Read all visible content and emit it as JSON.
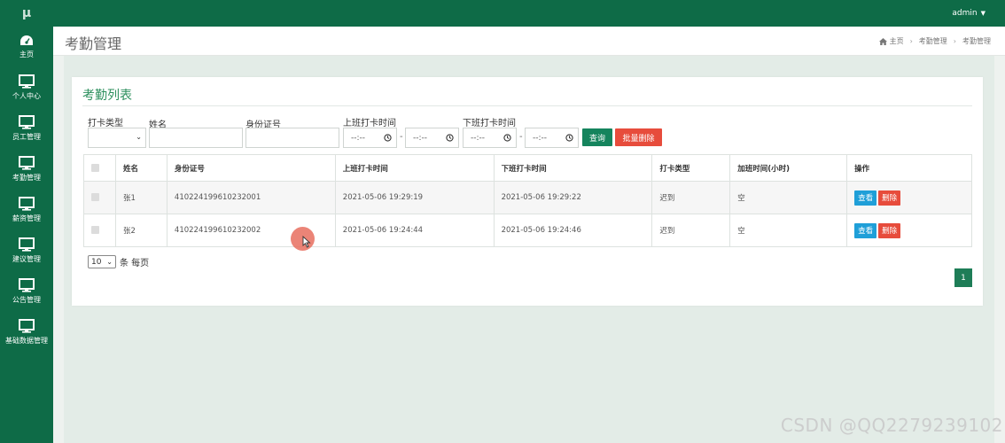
{
  "app": {
    "logo": "μ"
  },
  "topbar": {
    "user": "admin"
  },
  "sidebar": {
    "items": [
      {
        "label": "主页",
        "icon": "dashboard-icon"
      },
      {
        "label": "个人中心",
        "icon": "monitor-icon"
      },
      {
        "label": "员工管理",
        "icon": "monitor-icon"
      },
      {
        "label": "考勤管理",
        "icon": "monitor-icon"
      },
      {
        "label": "薪资管理",
        "icon": "monitor-icon"
      },
      {
        "label": "建议管理",
        "icon": "monitor-icon"
      },
      {
        "label": "公告管理",
        "icon": "monitor-icon"
      },
      {
        "label": "基础数据管理",
        "icon": "monitor-icon"
      }
    ]
  },
  "header": {
    "title": "考勤管理",
    "breadcrumb": [
      "主页",
      "考勤管理",
      "考勤管理"
    ]
  },
  "card": {
    "title": "考勤列表"
  },
  "filters": {
    "type_label": "打卡类型",
    "name_label": "姓名",
    "id_label": "身份证号",
    "in_time_label": "上班打卡时间",
    "out_time_label": "下班打卡时间",
    "time_placeholder": "--:--",
    "range_sep": "-",
    "search_button": "查询",
    "batch_delete_button": "批量删除"
  },
  "table": {
    "headers": [
      "姓名",
      "身份证号",
      "上班打卡时间",
      "下班打卡时间",
      "打卡类型",
      "加班时间(小时)",
      "操作"
    ],
    "rows": [
      {
        "name": "张1",
        "id": "410224199610232001",
        "in": "2021-05-06 19:29:19",
        "out": "2021-05-06 19:29:22",
        "type": "迟到",
        "overtime": "空"
      },
      {
        "name": "张2",
        "id": "410224199610232002",
        "in": "2021-05-06 19:24:44",
        "out": "2021-05-06 19:24:46",
        "type": "迟到",
        "overtime": "空"
      }
    ],
    "view_label": "查看",
    "delete_label": "删除"
  },
  "pagination": {
    "page_size": "10",
    "page_size_suffix": "条 每页",
    "current_page": "1"
  },
  "watermark": "CSDN @QQ2279239102",
  "colors": {
    "primary": "#0e6b47",
    "accent": "#2c8f5d",
    "danger": "#e74c3c",
    "info": "#1f9fd8"
  }
}
